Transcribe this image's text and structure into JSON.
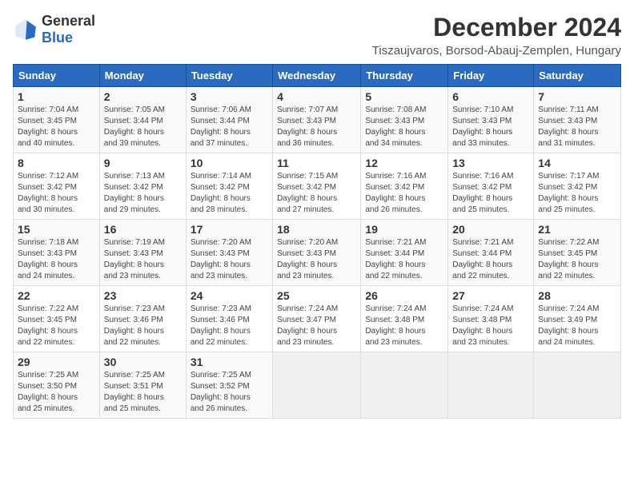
{
  "logo": {
    "general": "General",
    "blue": "Blue"
  },
  "header": {
    "title": "December 2024",
    "subtitle": "Tiszaujvaros, Borsod-Abauj-Zemplen, Hungary"
  },
  "weekdays": [
    "Sunday",
    "Monday",
    "Tuesday",
    "Wednesday",
    "Thursday",
    "Friday",
    "Saturday"
  ],
  "weeks": [
    [
      {
        "day": "1",
        "detail": "Sunrise: 7:04 AM\nSunset: 3:45 PM\nDaylight: 8 hours\nand 40 minutes."
      },
      {
        "day": "2",
        "detail": "Sunrise: 7:05 AM\nSunset: 3:44 PM\nDaylight: 8 hours\nand 39 minutes."
      },
      {
        "day": "3",
        "detail": "Sunrise: 7:06 AM\nSunset: 3:44 PM\nDaylight: 8 hours\nand 37 minutes."
      },
      {
        "day": "4",
        "detail": "Sunrise: 7:07 AM\nSunset: 3:43 PM\nDaylight: 8 hours\nand 36 minutes."
      },
      {
        "day": "5",
        "detail": "Sunrise: 7:08 AM\nSunset: 3:43 PM\nDaylight: 8 hours\nand 34 minutes."
      },
      {
        "day": "6",
        "detail": "Sunrise: 7:10 AM\nSunset: 3:43 PM\nDaylight: 8 hours\nand 33 minutes."
      },
      {
        "day": "7",
        "detail": "Sunrise: 7:11 AM\nSunset: 3:43 PM\nDaylight: 8 hours\nand 31 minutes."
      }
    ],
    [
      {
        "day": "8",
        "detail": "Sunrise: 7:12 AM\nSunset: 3:42 PM\nDaylight: 8 hours\nand 30 minutes."
      },
      {
        "day": "9",
        "detail": "Sunrise: 7:13 AM\nSunset: 3:42 PM\nDaylight: 8 hours\nand 29 minutes."
      },
      {
        "day": "10",
        "detail": "Sunrise: 7:14 AM\nSunset: 3:42 PM\nDaylight: 8 hours\nand 28 minutes."
      },
      {
        "day": "11",
        "detail": "Sunrise: 7:15 AM\nSunset: 3:42 PM\nDaylight: 8 hours\nand 27 minutes."
      },
      {
        "day": "12",
        "detail": "Sunrise: 7:16 AM\nSunset: 3:42 PM\nDaylight: 8 hours\nand 26 minutes."
      },
      {
        "day": "13",
        "detail": "Sunrise: 7:16 AM\nSunset: 3:42 PM\nDaylight: 8 hours\nand 25 minutes."
      },
      {
        "day": "14",
        "detail": "Sunrise: 7:17 AM\nSunset: 3:42 PM\nDaylight: 8 hours\nand 25 minutes."
      }
    ],
    [
      {
        "day": "15",
        "detail": "Sunrise: 7:18 AM\nSunset: 3:43 PM\nDaylight: 8 hours\nand 24 minutes."
      },
      {
        "day": "16",
        "detail": "Sunrise: 7:19 AM\nSunset: 3:43 PM\nDaylight: 8 hours\nand 23 minutes."
      },
      {
        "day": "17",
        "detail": "Sunrise: 7:20 AM\nSunset: 3:43 PM\nDaylight: 8 hours\nand 23 minutes."
      },
      {
        "day": "18",
        "detail": "Sunrise: 7:20 AM\nSunset: 3:43 PM\nDaylight: 8 hours\nand 23 minutes."
      },
      {
        "day": "19",
        "detail": "Sunrise: 7:21 AM\nSunset: 3:44 PM\nDaylight: 8 hours\nand 22 minutes."
      },
      {
        "day": "20",
        "detail": "Sunrise: 7:21 AM\nSunset: 3:44 PM\nDaylight: 8 hours\nand 22 minutes."
      },
      {
        "day": "21",
        "detail": "Sunrise: 7:22 AM\nSunset: 3:45 PM\nDaylight: 8 hours\nand 22 minutes."
      }
    ],
    [
      {
        "day": "22",
        "detail": "Sunrise: 7:22 AM\nSunset: 3:45 PM\nDaylight: 8 hours\nand 22 minutes."
      },
      {
        "day": "23",
        "detail": "Sunrise: 7:23 AM\nSunset: 3:46 PM\nDaylight: 8 hours\nand 22 minutes."
      },
      {
        "day": "24",
        "detail": "Sunrise: 7:23 AM\nSunset: 3:46 PM\nDaylight: 8 hours\nand 22 minutes."
      },
      {
        "day": "25",
        "detail": "Sunrise: 7:24 AM\nSunset: 3:47 PM\nDaylight: 8 hours\nand 23 minutes."
      },
      {
        "day": "26",
        "detail": "Sunrise: 7:24 AM\nSunset: 3:48 PM\nDaylight: 8 hours\nand 23 minutes."
      },
      {
        "day": "27",
        "detail": "Sunrise: 7:24 AM\nSunset: 3:48 PM\nDaylight: 8 hours\nand 23 minutes."
      },
      {
        "day": "28",
        "detail": "Sunrise: 7:24 AM\nSunset: 3:49 PM\nDaylight: 8 hours\nand 24 minutes."
      }
    ],
    [
      {
        "day": "29",
        "detail": "Sunrise: 7:25 AM\nSunset: 3:50 PM\nDaylight: 8 hours\nand 25 minutes."
      },
      {
        "day": "30",
        "detail": "Sunrise: 7:25 AM\nSunset: 3:51 PM\nDaylight: 8 hours\nand 25 minutes."
      },
      {
        "day": "31",
        "detail": "Sunrise: 7:25 AM\nSunset: 3:52 PM\nDaylight: 8 hours\nand 26 minutes."
      },
      {
        "day": "",
        "detail": ""
      },
      {
        "day": "",
        "detail": ""
      },
      {
        "day": "",
        "detail": ""
      },
      {
        "day": "",
        "detail": ""
      }
    ]
  ]
}
